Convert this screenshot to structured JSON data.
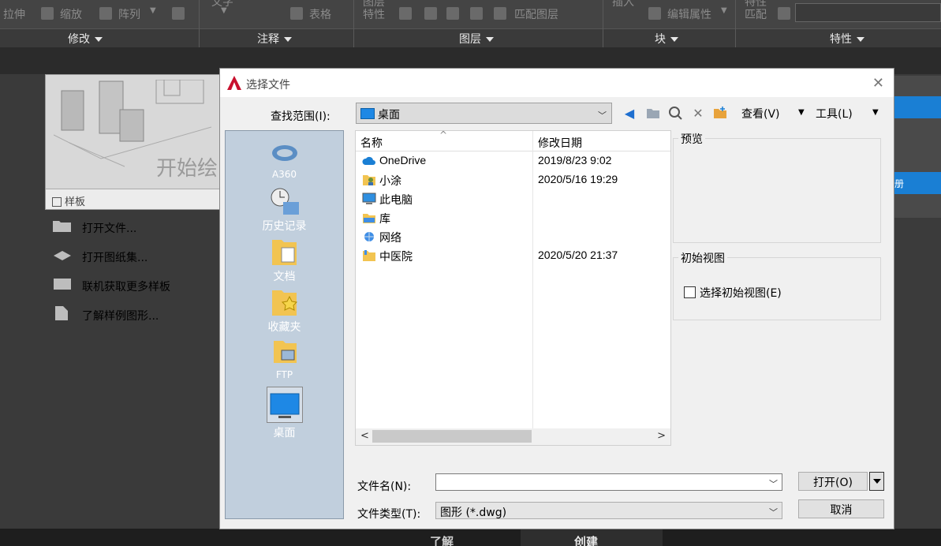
{
  "ribbon": {
    "row1": {
      "stretch": "拉伸",
      "scale": "缩放",
      "array": "阵列",
      "table": "表格",
      "layer_props": "特性",
      "match_layer": "匹配图层",
      "edit_attr": "编辑属性",
      "match": "匹配",
      "layer_top": "图层",
      "text_top": "文字",
      "insert_top": "插入",
      "props_top": "特性"
    },
    "panels": {
      "modify": "修改",
      "annotate": "注释",
      "layers": "图层",
      "block": "块",
      "properties": "特性"
    }
  },
  "start_page": {
    "template_title": "开始绘",
    "template_bar": "样板",
    "links": [
      {
        "label": "打开文件..."
      },
      {
        "label": "打开图纸集..."
      },
      {
        "label": "联机获取更多样板"
      },
      {
        "label": "了解样例图形..."
      }
    ],
    "bottom_tabs": {
      "learn": "了解",
      "create": "创建"
    },
    "right_fragment": "册"
  },
  "dialog": {
    "title": "选择文件",
    "lookin_label": "查找范围(I):",
    "lookin_value": "桌面",
    "toolbar": {
      "view": "查看(V)",
      "tools": "工具(L)"
    },
    "places": [
      {
        "label": "A360"
      },
      {
        "label": "历史记录"
      },
      {
        "label": "文档"
      },
      {
        "label": "收藏夹"
      },
      {
        "label": "FTP"
      },
      {
        "label": "桌面"
      }
    ],
    "columns": {
      "name": "名称",
      "modified": "修改日期"
    },
    "files": [
      {
        "name": "OneDrive",
        "date": "2019/8/23 9:02",
        "icon": "cloud-icon"
      },
      {
        "name": "小涂",
        "date": "2020/5/16 19:29",
        "icon": "user-folder-icon"
      },
      {
        "name": "此电脑",
        "date": "",
        "icon": "computer-icon"
      },
      {
        "name": "库",
        "date": "",
        "icon": "library-icon"
      },
      {
        "name": "网络",
        "date": "",
        "icon": "network-icon"
      },
      {
        "name": "中医院",
        "date": "2020/5/20 21:37",
        "icon": "folder-icon"
      }
    ],
    "preview_label": "预览",
    "initial_view_label": "初始视图",
    "select_initial_view": "选择初始视图(E)",
    "filename_label": "文件名(N):",
    "filename_value": "",
    "filetype_label": "文件类型(T):",
    "filetype_value": "图形 (*.dwg)",
    "open_button": "打开(O)",
    "cancel_button": "取消"
  },
  "colors": {
    "accent_blue": "#1a7fd4",
    "places_bg": "#c1cfdd",
    "logo_red": "#c8102e"
  }
}
